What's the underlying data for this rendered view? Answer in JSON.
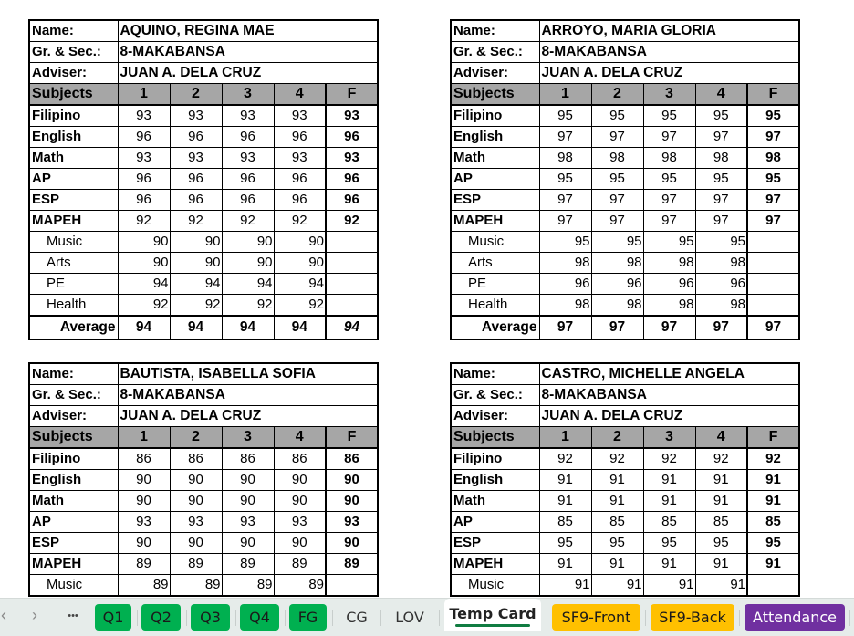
{
  "labels": {
    "name": "Name:",
    "grade_section": "Gr. & Sec.:",
    "adviser": "Adviser:",
    "subjects": "Subjects",
    "q1": "1",
    "q2": "2",
    "q3": "3",
    "q4": "4",
    "final": "F",
    "average": "Average"
  },
  "subject_names": [
    "Filipino",
    "English",
    "Math",
    "AP",
    "ESP",
    "MAPEH"
  ],
  "mapeh_components": [
    "Music",
    "Arts",
    "PE",
    "Health"
  ],
  "cards": [
    {
      "name": "AQUINO, REGINA MAE",
      "grade_section": "8-MAKABANSA",
      "adviser": "JUAN A. DELA CRUZ",
      "subjects": [
        {
          "q": [
            "93",
            "93",
            "93",
            "93"
          ],
          "f": "93"
        },
        {
          "q": [
            "96",
            "96",
            "96",
            "96"
          ],
          "f": "96"
        },
        {
          "q": [
            "93",
            "93",
            "93",
            "93"
          ],
          "f": "93"
        },
        {
          "q": [
            "96",
            "96",
            "96",
            "96"
          ],
          "f": "96"
        },
        {
          "q": [
            "96",
            "96",
            "96",
            "96"
          ],
          "f": "96"
        },
        {
          "q": [
            "92",
            "92",
            "92",
            "92"
          ],
          "f": "92"
        }
      ],
      "mapeh": [
        {
          "q": [
            "90",
            "90",
            "90",
            "90"
          ]
        },
        {
          "q": [
            "90",
            "90",
            "90",
            "90"
          ]
        },
        {
          "q": [
            "94",
            "94",
            "94",
            "94"
          ]
        },
        {
          "q": [
            "92",
            "92",
            "92",
            "92"
          ]
        }
      ],
      "average": {
        "q": [
          "94",
          "94",
          "94",
          "94"
        ],
        "f": "94"
      }
    },
    {
      "name": "ARROYO, MARIA GLORIA",
      "grade_section": "8-MAKABANSA",
      "adviser": "JUAN A. DELA CRUZ",
      "subjects": [
        {
          "q": [
            "95",
            "95",
            "95",
            "95"
          ],
          "f": "95"
        },
        {
          "q": [
            "97",
            "97",
            "97",
            "97"
          ],
          "f": "97"
        },
        {
          "q": [
            "98",
            "98",
            "98",
            "98"
          ],
          "f": "98"
        },
        {
          "q": [
            "95",
            "95",
            "95",
            "95"
          ],
          "f": "95"
        },
        {
          "q": [
            "97",
            "97",
            "97",
            "97"
          ],
          "f": "97"
        },
        {
          "q": [
            "97",
            "97",
            "97",
            "97"
          ],
          "f": "97"
        }
      ],
      "mapeh": [
        {
          "q": [
            "95",
            "95",
            "95",
            "95"
          ]
        },
        {
          "q": [
            "98",
            "98",
            "98",
            "98"
          ]
        },
        {
          "q": [
            "96",
            "96",
            "96",
            "96"
          ]
        },
        {
          "q": [
            "98",
            "98",
            "98",
            "98"
          ]
        }
      ],
      "average": {
        "q": [
          "97",
          "97",
          "97",
          "97"
        ],
        "f": "97"
      }
    },
    {
      "name": "BAUTISTA, ISABELLA SOFIA",
      "grade_section": "8-MAKABANSA",
      "adviser": "JUAN A. DELA CRUZ",
      "subjects": [
        {
          "q": [
            "86",
            "86",
            "86",
            "86"
          ],
          "f": "86"
        },
        {
          "q": [
            "90",
            "90",
            "90",
            "90"
          ],
          "f": "90"
        },
        {
          "q": [
            "90",
            "90",
            "90",
            "90"
          ],
          "f": "90"
        },
        {
          "q": [
            "93",
            "93",
            "93",
            "93"
          ],
          "f": "93"
        },
        {
          "q": [
            "90",
            "90",
            "90",
            "90"
          ],
          "f": "90"
        },
        {
          "q": [
            "89",
            "89",
            "89",
            "89"
          ],
          "f": "89"
        }
      ],
      "mapeh": [
        {
          "q": [
            "89",
            "89",
            "89",
            "89"
          ]
        }
      ]
    },
    {
      "name": "CASTRO, MICHELLE ANGELA",
      "grade_section": "8-MAKABANSA",
      "adviser": "JUAN A. DELA CRUZ",
      "subjects": [
        {
          "q": [
            "92",
            "92",
            "92",
            "92"
          ],
          "f": "92"
        },
        {
          "q": [
            "91",
            "91",
            "91",
            "91"
          ],
          "f": "91"
        },
        {
          "q": [
            "91",
            "91",
            "91",
            "91"
          ],
          "f": "91"
        },
        {
          "q": [
            "85",
            "85",
            "85",
            "85"
          ],
          "f": "85"
        },
        {
          "q": [
            "95",
            "95",
            "95",
            "95"
          ],
          "f": "95"
        },
        {
          "q": [
            "91",
            "91",
            "91",
            "91"
          ],
          "f": "91"
        }
      ],
      "mapeh": [
        {
          "q": [
            "91",
            "91",
            "91",
            "91"
          ]
        }
      ]
    }
  ],
  "tabbar": {
    "prev_icon": "chevron-left-icon",
    "next_icon": "chevron-right-icon",
    "more_icon": "more-icon",
    "prev_glyph": "‹",
    "next_glyph": "›",
    "more_glyph": "•••",
    "active_tab": "Temp Card",
    "tabs": [
      {
        "label": "Q1",
        "color": "#00b050"
      },
      {
        "label": "Q2",
        "color": "#00b050"
      },
      {
        "label": "Q3",
        "color": "#00b050"
      },
      {
        "label": "Q4",
        "color": "#00b050"
      },
      {
        "label": "FG",
        "color": "#00b050"
      },
      {
        "label": "CG"
      },
      {
        "label": "LOV"
      },
      {
        "label": "Temp Card",
        "active": true,
        "underline_color": "#107c41"
      },
      {
        "label": "SF9-Front",
        "color": "#ffc000"
      },
      {
        "label": "SF9-Back",
        "color": "#ffc000"
      },
      {
        "label": "Attendance",
        "color": "#7030a0"
      }
    ]
  },
  "colors": {
    "header_gray": "#a6a6a6",
    "tabbar_bg": "#e6ecea"
  }
}
